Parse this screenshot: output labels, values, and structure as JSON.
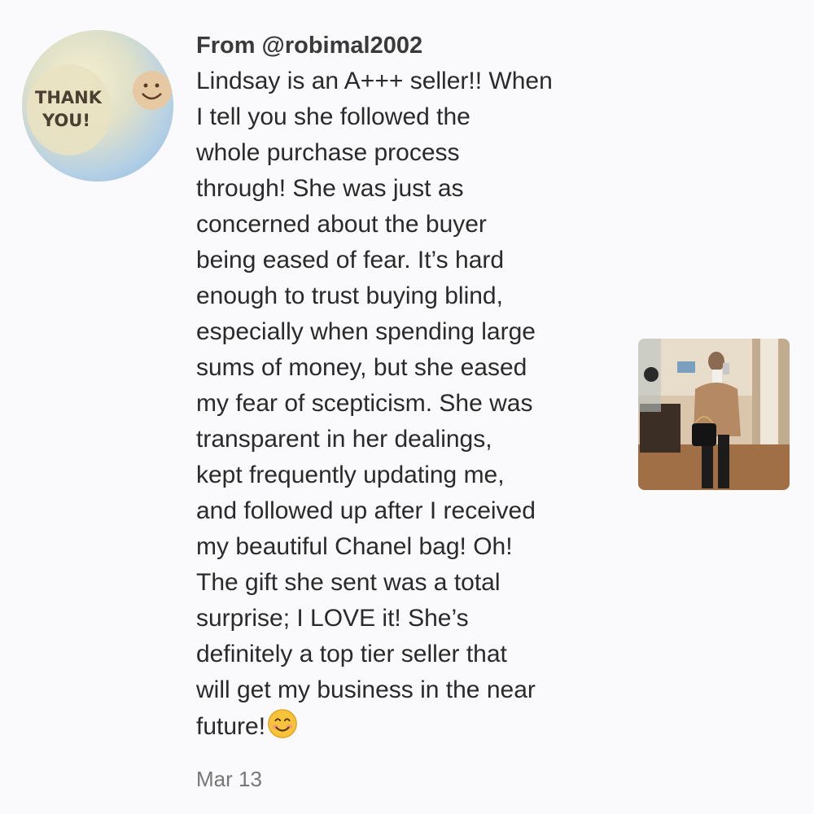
{
  "avatar": {
    "sticker_text": "THANK YOU!",
    "sticker_line1": "THANK",
    "sticker_line2": "YOU!"
  },
  "comment": {
    "author": "From @robimal2002",
    "lines": [
      "Lindsay is an A+++ seller!! When",
      "I tell you she followed the",
      "whole purchase process",
      "through! She was just as",
      "concerned about the buyer",
      "being eased of fear. It’s hard",
      "enough to trust buying blind,",
      "especially when spending large",
      "sums of money, but she eased",
      "my fear of scepticism. She was",
      "transparent in her dealings,",
      "kept frequently updating me,",
      "and followed up after I received",
      "my beautiful Chanel bag! Oh!",
      "The gift she sent was a total",
      "surprise; I LOVE it! She’s",
      "definitely a top tier seller that",
      "will get my business in the near",
      "future!"
    ],
    "emoji": "smiling-face-icon",
    "date": "Mar 13"
  },
  "colors": {
    "background": "#faf9fb",
    "text": "#2a2a2a",
    "muted": "#777777"
  }
}
